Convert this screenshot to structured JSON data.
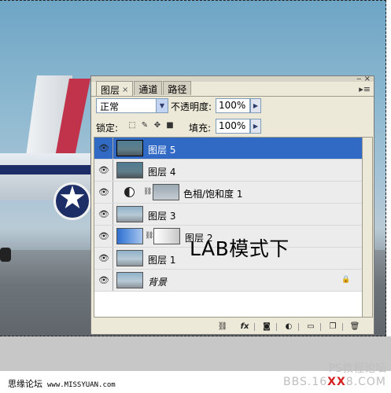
{
  "tabs": [
    {
      "label": "图层",
      "close": "×",
      "active": true
    },
    {
      "label": "通道",
      "active": false
    },
    {
      "label": "路径",
      "active": false
    }
  ],
  "panel": {
    "blend_mode": "正常",
    "opacity_label": "不透明度:",
    "opacity_value": "100%",
    "lock_label": "锁定:",
    "fill_label": "填充:",
    "fill_value": "100%"
  },
  "layers": [
    {
      "name": "图层 5",
      "selected": true
    },
    {
      "name": "图层 4",
      "selected": false
    },
    {
      "name": "色相/饱和度 1",
      "selected": false
    },
    {
      "name": "图层 3",
      "selected": false
    },
    {
      "name": "图层 2",
      "selected": false
    },
    {
      "name": "图层 1",
      "selected": false
    },
    {
      "name": "背景",
      "selected": false
    }
  ],
  "annotation": "LAB模式下",
  "icons": {
    "eye": "eye-icon",
    "link": "link-icon",
    "lock": "lock-icon",
    "footer": [
      "link-layers-icon",
      "fx-icon",
      "add-mask-icon",
      "adjustment-layer-icon",
      "new-group-icon",
      "new-layer-icon",
      "delete-layer-icon"
    ]
  },
  "watermark": {
    "left_title": "思缘论坛",
    "left_site": "www.MISSYUAN.com",
    "right_title": "PS教程论坛",
    "right_url_start": "BBS.16",
    "right_url_xx": "XX",
    "right_url_end": "8.COM"
  },
  "colors": {
    "selection": "#316ac5",
    "panel_bg": "#ece9d8",
    "accent_red": "#d52020"
  }
}
